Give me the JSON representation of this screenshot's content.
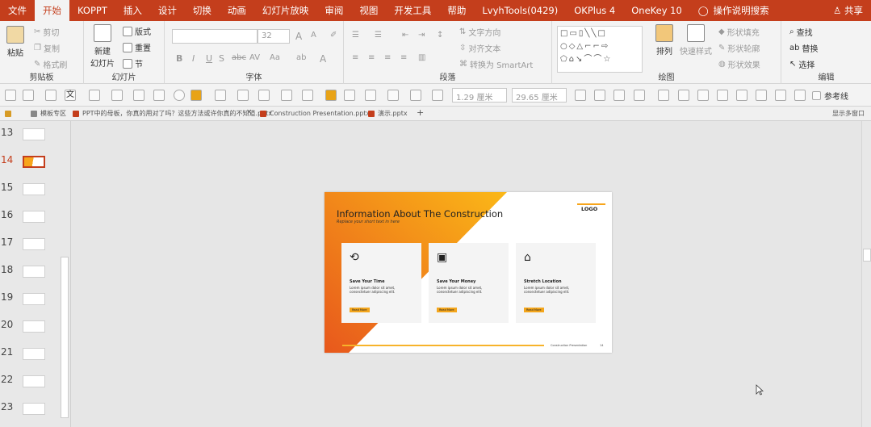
{
  "ribbon_tabs": [
    "文件",
    "开始",
    "KOPPT",
    "插入",
    "设计",
    "切换",
    "动画",
    "幻灯片放映",
    "审阅",
    "视图",
    "开发工具",
    "帮助",
    "LvyhTools(0429)",
    "OKPlus 4",
    "OneKey 10"
  ],
  "active_tab": "开始",
  "tell_me": "操作说明搜索",
  "share": "共享",
  "groups": {
    "clipboard": {
      "label": "剪贴板",
      "paste": "粘贴",
      "cut": "剪切",
      "copy": "复制",
      "format_painter": "格式刷"
    },
    "slides": {
      "label": "幻灯片",
      "new_slide": "新建\n幻灯片",
      "layout": "版式",
      "reset": "重置",
      "section": "节"
    },
    "font": {
      "label": "字体",
      "size": "32"
    },
    "paragraph": {
      "label": "段落",
      "text_direction": "文字方向",
      "align_text": "对齐文本",
      "smartart": "转换为 SmartArt"
    },
    "drawing": {
      "label": "绘图",
      "arrange": "排列",
      "quick_styles": "快速样式",
      "shape_fill": "形状填充",
      "shape_outline": "形状轮廓",
      "shape_effects": "形状效果"
    },
    "editing": {
      "label": "编辑",
      "find": "查找",
      "replace": "替换",
      "select": "选择"
    }
  },
  "qat": {
    "width": "1.29 厘米",
    "height": "29.65 厘米",
    "guides": "参考线"
  },
  "doc_tabs": [
    {
      "label": "模板专区"
    },
    {
      "label": "PPT中的母板，你真的用对了吗？这些方法或许你真的不知道.pptx"
    },
    {
      "label": "Construction Presentation.pptx"
    },
    {
      "label": "演示.pptx"
    }
  ],
  "show_multi_window": "显示多窗口",
  "thumbnails": [
    "13",
    "14",
    "15",
    "16",
    "17",
    "18",
    "19",
    "20",
    "21",
    "22",
    "23"
  ],
  "selected_slide": "14",
  "slide": {
    "title": "Information About The Construction",
    "subtitle": "Replace your short text in here",
    "logo": "LOGO",
    "cards": [
      {
        "icon": "history-icon",
        "title": "Save Your Time",
        "text": "Lorem ipsum dolor sit amet, consectetuer adipiscing elit.",
        "button": "Read More"
      },
      {
        "icon": "money-icon",
        "title": "Save Your Money",
        "text": "Lorem ipsum dolor sit amet, consectetuer adipiscing elit.",
        "button": "Read More"
      },
      {
        "icon": "bank-icon",
        "title": "Stretch Location",
        "text": "Lorem ipsum dolor sit amet, consectetuer adipiscing elit.",
        "button": "Read More"
      }
    ],
    "footer": "Construction Presentation",
    "page_number": "14",
    "accent": "#f7a51b",
    "accent_dark": "#e8581c"
  },
  "colors": {
    "ribbon": "#c43e1c",
    "selection": "#c43e1c"
  }
}
